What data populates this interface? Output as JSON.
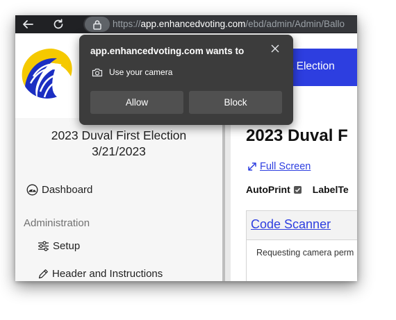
{
  "browser": {
    "url_protocol": "https://",
    "url_host": "app.enhancedvoting.com",
    "url_path": "/ebd/admin/Admin/Ballo"
  },
  "header": {
    "election_button_label": "t Election"
  },
  "sidebar": {
    "election_name": "2023 Duval First Election",
    "election_date": "3/21/2023",
    "dashboard_label": "Dashboard",
    "section_label": "Administration",
    "items": [
      {
        "label": "Setup",
        "icon": "sliders-icon"
      },
      {
        "label": "Header and Instructions",
        "icon": "pencil-icon"
      }
    ]
  },
  "main": {
    "title": "2023 Duval F",
    "fullscreen_label": "Full Screen",
    "autoprint_label": "AutoPrint",
    "autoprint_checked": true,
    "labeltest_label": "LabelTe",
    "scanner_title": "Code Scanner",
    "scanner_status": "Requesting camera perm"
  },
  "permission_popup": {
    "title": "app.enhancedvoting.com wants to",
    "permission_label": "Use your camera",
    "allow_label": "Allow",
    "block_label": "Block"
  },
  "colors": {
    "accent_blue": "#2d3ee0",
    "chrome_dark": "#202124",
    "popup_bg": "#3c3c3c",
    "logo_yellow": "#f5c900"
  }
}
